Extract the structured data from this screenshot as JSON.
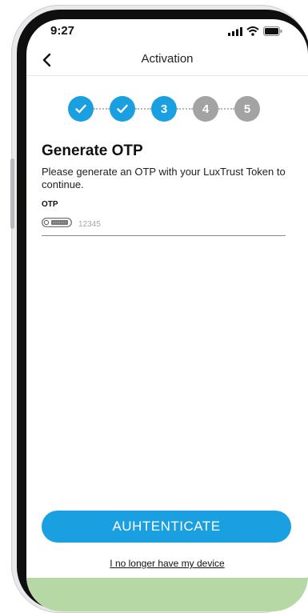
{
  "status_bar": {
    "time": "9:27",
    "icons": [
      "cellular-signal-icon",
      "wifi-icon",
      "battery-icon"
    ]
  },
  "nav": {
    "title": "Activation",
    "back_icon": "chevron-left-icon"
  },
  "stepper": {
    "steps": [
      {
        "state": "done",
        "label": ""
      },
      {
        "state": "done",
        "label": ""
      },
      {
        "state": "active",
        "label": "3"
      },
      {
        "state": "pending",
        "label": "4"
      },
      {
        "state": "pending",
        "label": "5"
      }
    ],
    "done_icon": "checkmark-icon"
  },
  "content": {
    "heading": "Generate OTP",
    "description": "Please generate an OTP with your LuxTrust Token to continue.",
    "otp_label": "OTP",
    "otp_value": "",
    "otp_placeholder": "12345",
    "token_icon": "token-device-icon"
  },
  "actions": {
    "authenticate_label": "AUHTENTICATE",
    "no_device_link": "I no longer have my device"
  },
  "colors": {
    "accent": "#1a9fe1",
    "step_pending": "#a3a3a3",
    "bottom_strip": "#b5d8a5"
  }
}
